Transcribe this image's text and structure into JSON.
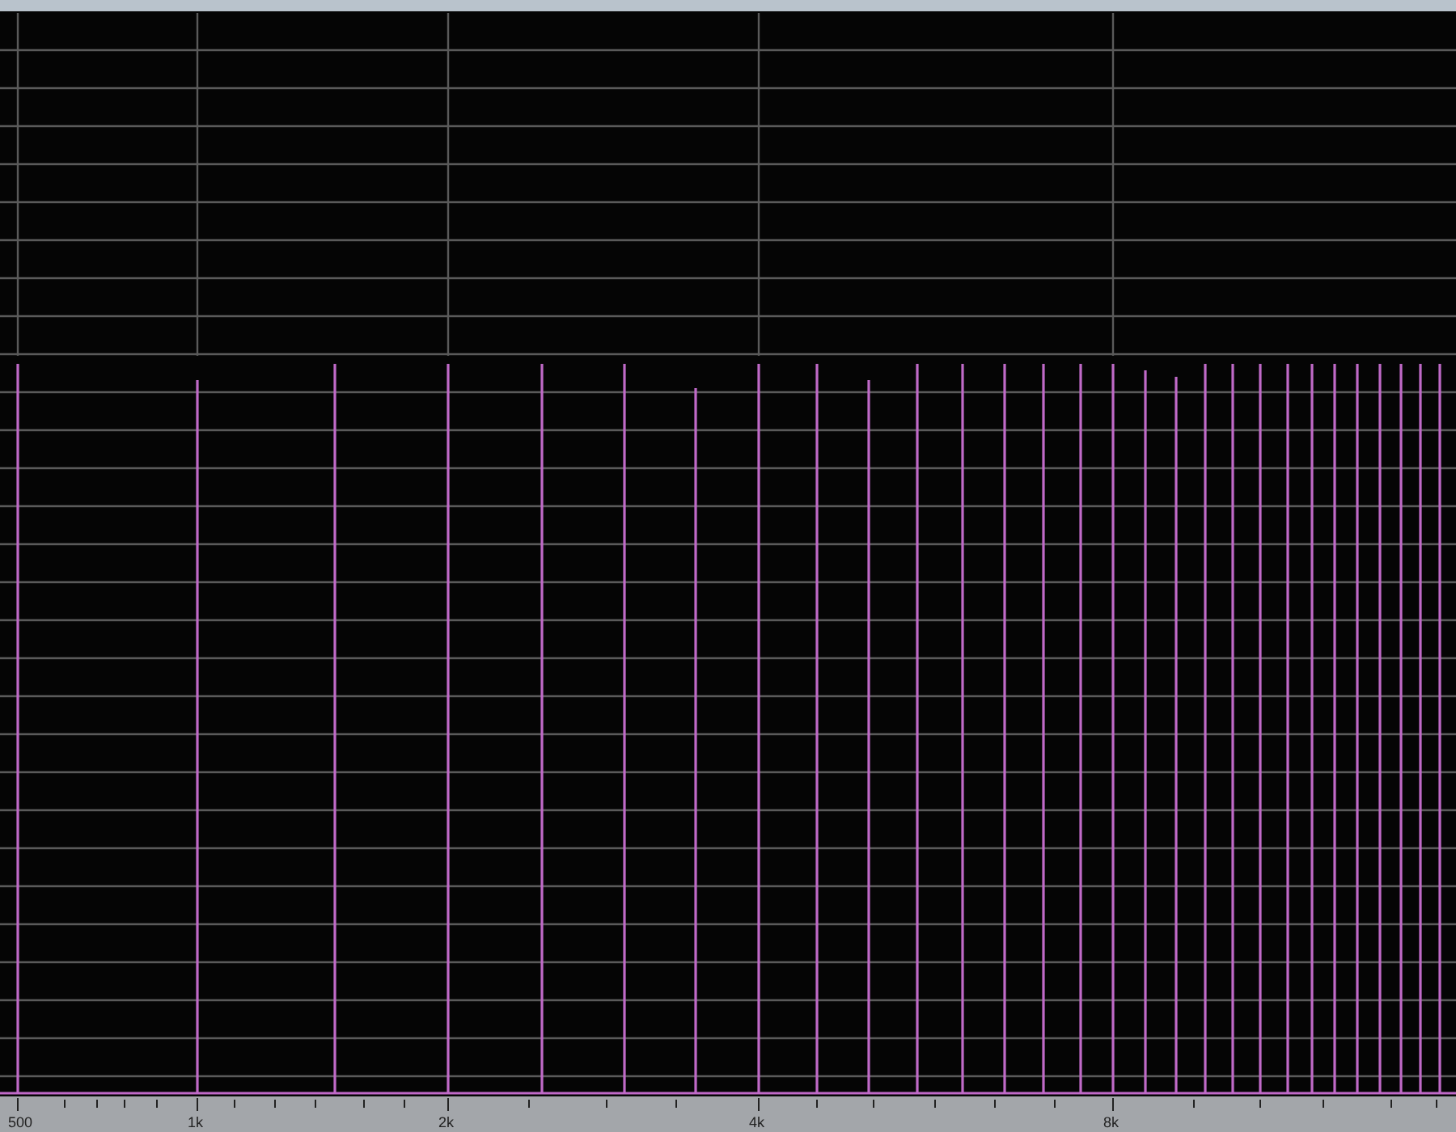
{
  "frequency_axis": {
    "labels": [
      "500",
      "1k",
      "2k",
      "4k",
      "8k"
    ]
  }
}
